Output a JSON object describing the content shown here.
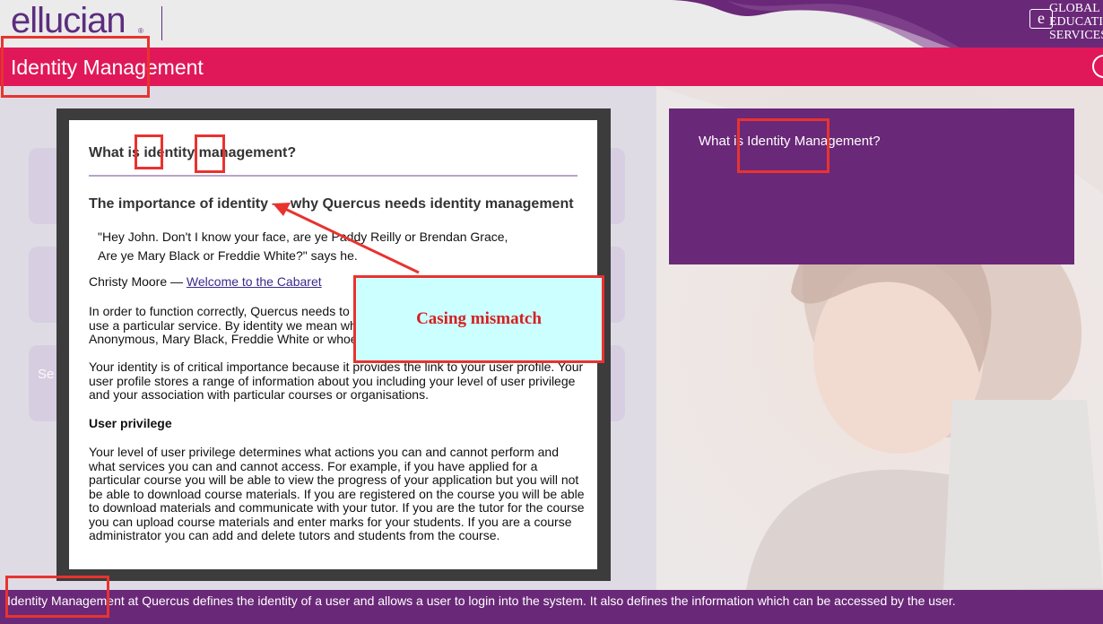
{
  "header": {
    "logo_text": "ellucian",
    "logo_reg": "®",
    "badge_letter": "e",
    "badge_text": "GLOBAL\nEDUCATION\nSERVICES"
  },
  "titlebar": {
    "title": "Identity Management"
  },
  "tiles": {
    "tile3_text": "Se"
  },
  "right_panel": {
    "text": "What is Identity Management?"
  },
  "modal": {
    "heading": "What is identity management?",
    "subheading": "The importance of identity — why Quercus needs identity management",
    "quote_line1": "\"Hey John. Don't I know your face, are ye Paddy Reilly or Brendan Grace,",
    "quote_line2": "Are ye Mary Black or Freddie White?\" says he.",
    "cite_author": "Christy Moore — ",
    "cite_link": "Welcome to the Cabaret",
    "para1": "In order to function correctly, Quercus needs to know the identity of a user who wishes to use a particular service. By identity we mean who a user is, for example John Anonymous, Mary Black, Freddie White or whoever.",
    "para2": "Your identity is of critical importance because it provides the link to your user profile. Your user profile stores a range of information about you including your level of user privilege and your association with particular courses or organisations.",
    "privilege_heading": "User privilege",
    "para3": "Your level of user privilege determines what actions you can and cannot perform and what services you can and cannot access. For example, if you have applied for a particular course you will be able to view the progress of your application but you will not be able to download course materials. If you are registered on the course you will be able to download materials and communicate with your tutor. If you are the tutor for the course you can upload course materials and enter marks for your students. If you are a course administrator you can add and delete tutors and students from the course."
  },
  "annotation": {
    "callout_text": "Casing mismatch"
  },
  "footer": {
    "text": "Identity Management at Quercus defines the identity of a user and allows a user to login into the system. It also defines the information which can be accessed by the user."
  },
  "colors": {
    "brand_purple": "#6a2878",
    "title_pink": "#e0185a",
    "annotation_red": "#e8332f",
    "callout_bg": "#ccffff"
  }
}
